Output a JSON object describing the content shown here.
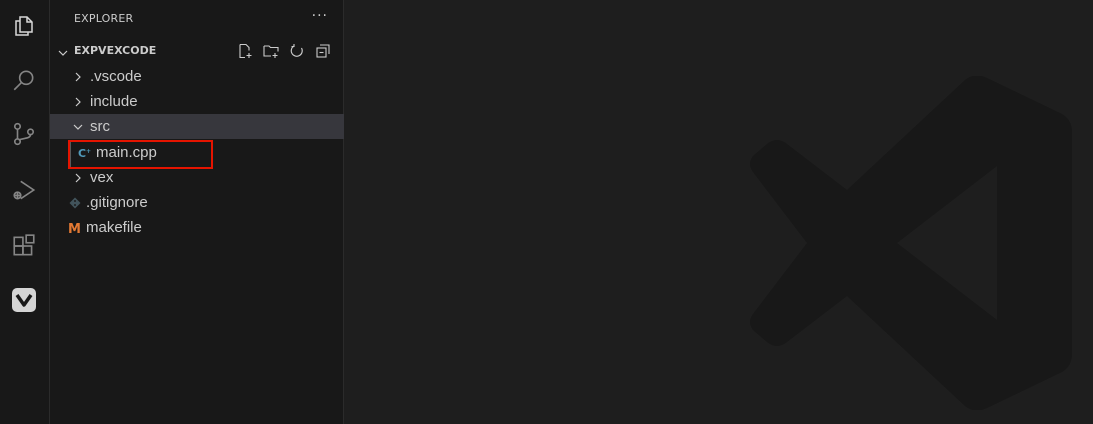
{
  "sidebar": {
    "title": "EXPLORER",
    "more_label": "···"
  },
  "workspace": {
    "name": "EXPVEXCODE",
    "actions": [
      "new-file-icon",
      "new-folder-icon",
      "refresh-icon",
      "collapse-all-icon"
    ]
  },
  "tree": {
    "items": [
      {
        "label": ".vscode",
        "type": "folder",
        "expanded": false
      },
      {
        "label": "include",
        "type": "folder",
        "expanded": false
      },
      {
        "label": "src",
        "type": "folder",
        "expanded": true
      },
      {
        "label": "main.cpp",
        "type": "file",
        "icon": "cpp-file-icon"
      },
      {
        "label": "vex",
        "type": "folder",
        "expanded": false
      },
      {
        "label": ".gitignore",
        "type": "file",
        "icon": "git-file-icon"
      },
      {
        "label": "makefile",
        "type": "file",
        "icon": "makefile-icon"
      }
    ]
  },
  "activity_bar": [
    "explorer-icon",
    "search-icon",
    "source-control-icon",
    "run-debug-icon",
    "extensions-icon",
    "vex-extension-icon"
  ],
  "colors": {
    "highlight": "#e51400",
    "cpp": "#519aba",
    "makefile": "#e37933",
    "git": "#41535b"
  }
}
